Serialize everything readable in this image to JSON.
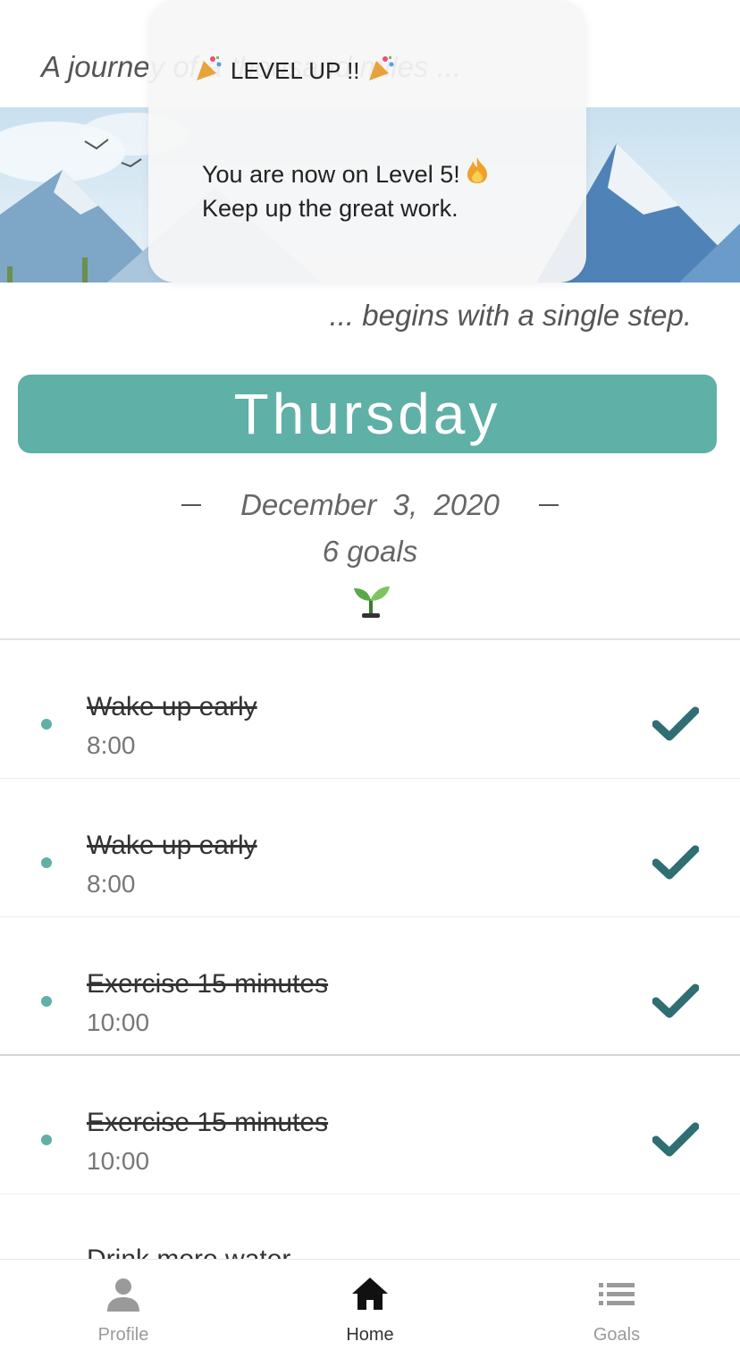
{
  "header": {
    "quote_start": "A journey of a thousand miles ...",
    "quote_end": "... begins with a single step."
  },
  "popup": {
    "title": "LEVEL UP !!",
    "title_icons": [
      "party-popper-icon",
      "party-popper-icon"
    ],
    "message_line1": "You are now on Level 5!",
    "message_line1_icon": "fire-icon",
    "message_line2": "Keep up the great work."
  },
  "day": {
    "weekday": "Thursday",
    "date": "December  3,  2020",
    "goal_count": "6 goals",
    "icon": "sprout-icon"
  },
  "goals": [
    {
      "title": "Wake up early",
      "time": "8:00",
      "completed": true
    },
    {
      "title": "Wake up early",
      "time": "8:00",
      "completed": true
    },
    {
      "title": "Exercise 15 minutes",
      "time": "10:00",
      "completed": true
    },
    {
      "title": "Exercise 15 minutes",
      "time": "10:00",
      "completed": true
    },
    {
      "title": "Drink more water",
      "time": "",
      "completed": true
    }
  ],
  "nav": {
    "items": [
      {
        "label": "Profile",
        "icon": "person-icon",
        "active": false
      },
      {
        "label": "Home",
        "icon": "home-icon",
        "active": true
      },
      {
        "label": "Goals",
        "icon": "list-icon",
        "active": false
      }
    ]
  },
  "colors": {
    "accent": "#5fb0a6",
    "check": "#2f6e73"
  }
}
